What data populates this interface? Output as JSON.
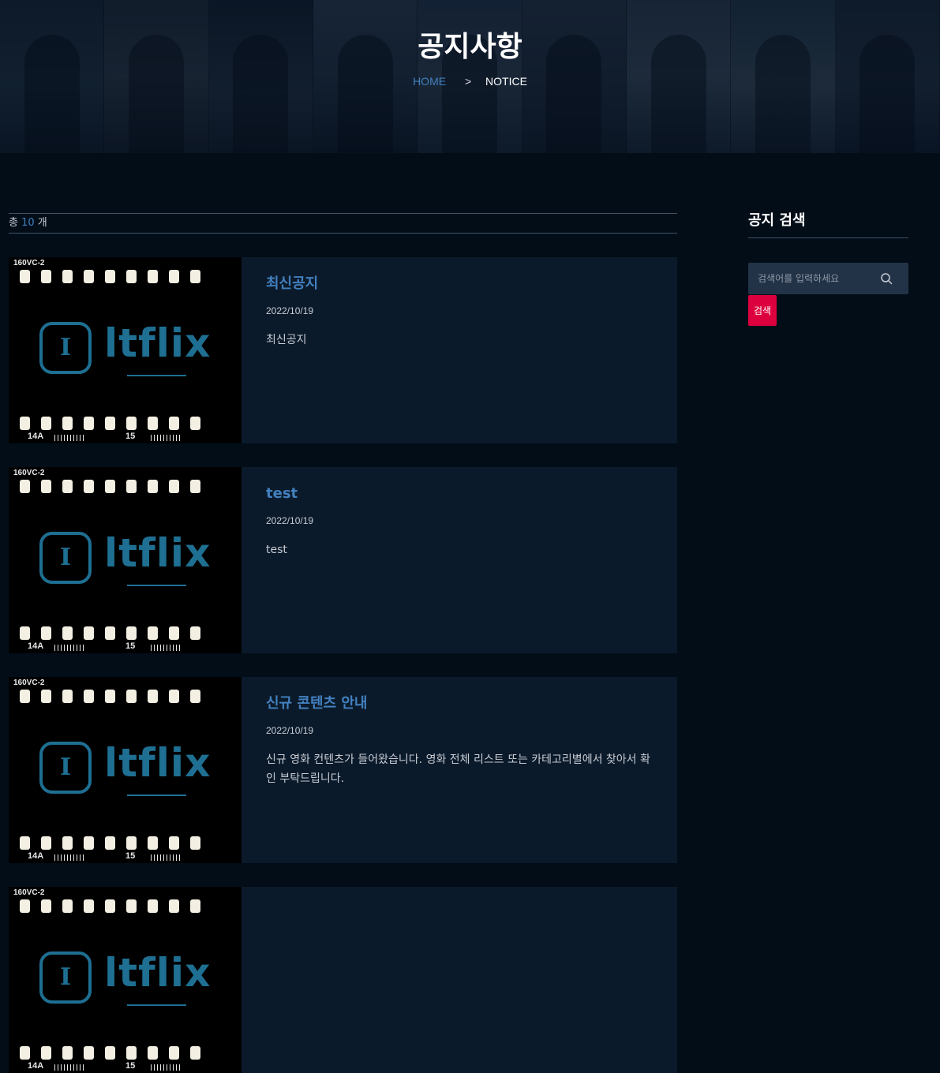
{
  "hero": {
    "title": "공지사항",
    "breadcrumb": {
      "home": "HOME",
      "separator": ">",
      "current": "NOTICE"
    }
  },
  "list": {
    "count_prefix": "총",
    "count": "10",
    "count_suffix": "개",
    "thumbnail": {
      "film_label": "160VC-2",
      "frame_left": "14A",
      "frame_right": "15",
      "logo_letter": "I",
      "logo_text": "ltflix"
    },
    "items": [
      {
        "title": "최신공지",
        "date": "2022/10/19",
        "text": "최신공지"
      },
      {
        "title": "test",
        "date": "2022/10/19",
        "text": "test"
      },
      {
        "title": "신규 콘텐츠 안내",
        "date": "2022/10/19",
        "text": "신규 영화 컨텐츠가 들어왔습니다. 영화 전체 리스트 또는 카테고리별에서 찾아서 확인 부탁드립니다."
      },
      {
        "title": "",
        "date": "",
        "text": ""
      }
    ]
  },
  "sidebar": {
    "title": "공지 검색",
    "search_placeholder": "검색어를 입력하세요",
    "search_button": "검색"
  },
  "colors": {
    "background": "#020d18",
    "card": "#0b1a2a",
    "accent_blue": "#4280bf",
    "button_red": "#dd003f",
    "logo_teal": "#1e6f92"
  }
}
